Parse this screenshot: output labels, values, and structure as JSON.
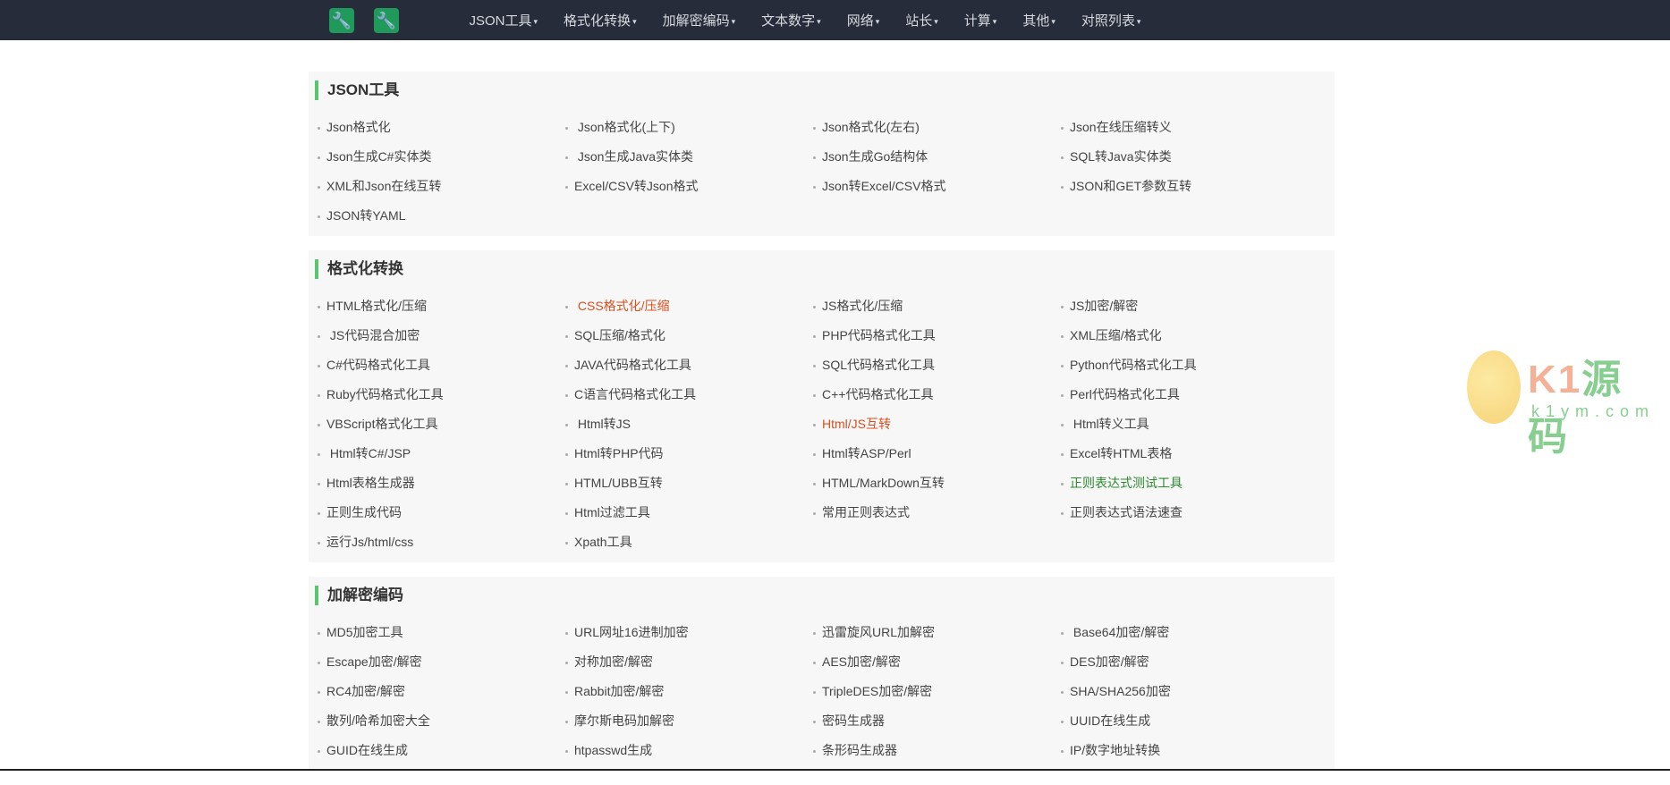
{
  "nav": {
    "logo_glyph": "🔧",
    "menu": [
      "JSON工具",
      "格式化转换",
      "加解密编码",
      "文本数字",
      "网络",
      "站长",
      "计算",
      "其他",
      "对照列表"
    ],
    "caret": "▾"
  },
  "colors": {
    "nav_bg": "#262c3a",
    "accent": "#5bc46e",
    "orange": "#d9501e",
    "green": "#2d8a2d"
  },
  "sections": [
    {
      "title": "JSON工具",
      "items": [
        {
          "label": "Json格式化"
        },
        {
          "label": " Json格式化(上下)"
        },
        {
          "label": "Json格式化(左右)"
        },
        {
          "label": "Json在线压缩转义"
        },
        {
          "label": "Json生成C#实体类"
        },
        {
          "label": " Json生成Java实体类"
        },
        {
          "label": "Json生成Go结构体"
        },
        {
          "label": "SQL转Java实体类"
        },
        {
          "label": "XML和Json在线互转"
        },
        {
          "label": "Excel/CSV转Json格式"
        },
        {
          "label": "Json转Excel/CSV格式"
        },
        {
          "label": "JSON和GET参数互转"
        },
        {
          "label": "JSON转YAML"
        }
      ]
    },
    {
      "title": "格式化转换",
      "items": [
        {
          "label": "HTML格式化/压缩"
        },
        {
          "label": " CSS格式化/压缩",
          "style": "orange"
        },
        {
          "label": "JS格式化/压缩"
        },
        {
          "label": "JS加密/解密"
        },
        {
          "label": " JS代码混合加密"
        },
        {
          "label": "SQL压缩/格式化"
        },
        {
          "label": "PHP代码格式化工具"
        },
        {
          "label": "XML压缩/格式化"
        },
        {
          "label": "C#代码格式化工具"
        },
        {
          "label": "JAVA代码格式化工具"
        },
        {
          "label": "SQL代码格式化工具"
        },
        {
          "label": "Python代码格式化工具"
        },
        {
          "label": "Ruby代码格式化工具"
        },
        {
          "label": "C语言代码格式化工具"
        },
        {
          "label": "C++代码格式化工具"
        },
        {
          "label": "Perl代码格式化工具"
        },
        {
          "label": "VBScript格式化工具"
        },
        {
          "label": " Html转JS"
        },
        {
          "label": "Html/JS互转",
          "style": "orange"
        },
        {
          "label": " Html转义工具"
        },
        {
          "label": " Html转C#/JSP"
        },
        {
          "label": "Html转PHP代码"
        },
        {
          "label": "Html转ASP/Perl"
        },
        {
          "label": "Excel转HTML表格"
        },
        {
          "label": "Html表格生成器"
        },
        {
          "label": "HTML/UBB互转"
        },
        {
          "label": "HTML/MarkDown互转"
        },
        {
          "label": "正则表达式测试工具",
          "style": "green"
        },
        {
          "label": "正则生成代码"
        },
        {
          "label": "Html过滤工具"
        },
        {
          "label": "常用正则表达式"
        },
        {
          "label": "正则表达式语法速查"
        },
        {
          "label": "运行Js/html/css"
        },
        {
          "label": "Xpath工具"
        }
      ]
    },
    {
      "title": "加解密编码",
      "items": [
        {
          "label": "MD5加密工具"
        },
        {
          "label": "URL网址16进制加密"
        },
        {
          "label": "迅雷旋风URL加解密"
        },
        {
          "label": " Base64加密/解密"
        },
        {
          "label": "Escape加密/解密"
        },
        {
          "label": "对称加密/解密"
        },
        {
          "label": "AES加密/解密"
        },
        {
          "label": "DES加密/解密"
        },
        {
          "label": "RC4加密/解密"
        },
        {
          "label": "Rabbit加密/解密"
        },
        {
          "label": "TripleDES加密/解密"
        },
        {
          "label": "SHA/SHA256加密"
        },
        {
          "label": "散列/哈希加密大全"
        },
        {
          "label": "摩尔斯电码加解密"
        },
        {
          "label": "密码生成器"
        },
        {
          "label": "UUID在线生成"
        },
        {
          "label": "GUID在线生成"
        },
        {
          "label": "htpasswd生成"
        },
        {
          "label": "条形码生成器"
        },
        {
          "label": "IP/数字地址转换"
        }
      ]
    }
  ],
  "watermark": {
    "brand_k1": "K1",
    "brand_cn": "源码",
    "domain": "k1ym.com"
  }
}
